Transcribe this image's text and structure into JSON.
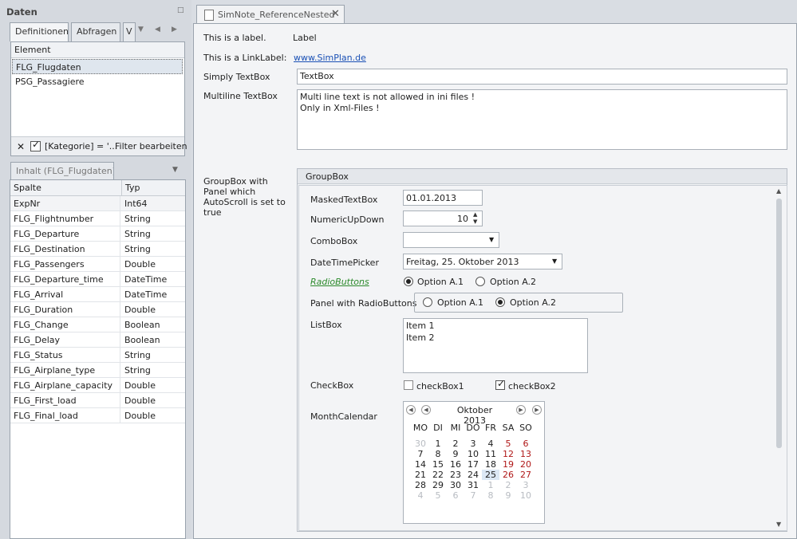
{
  "left": {
    "title": "Daten",
    "tabs": [
      "Definitionen",
      "Abfragen",
      "V"
    ],
    "elements_header": "Element",
    "elements": [
      "FLG_Flugdaten",
      "PSG_Passagiere"
    ],
    "filter_text": "[Kategorie] = '...",
    "filter_edit": "Filter bearbeiten",
    "content_tab": "Inhalt (FLG_Flugdaten)",
    "columns": {
      "col": "Spalte",
      "type": "Typ"
    },
    "rows": [
      {
        "name": "ExpNr",
        "type": "Int64"
      },
      {
        "name": "FLG_Flightnumber",
        "type": "String"
      },
      {
        "name": "FLG_Departure",
        "type": "String"
      },
      {
        "name": "FLG_Destination",
        "type": "String"
      },
      {
        "name": "FLG_Passengers",
        "type": "Double"
      },
      {
        "name": "FLG_Departure_time",
        "type": "DateTime"
      },
      {
        "name": "FLG_Arrival",
        "type": "DateTime"
      },
      {
        "name": "FLG_Duration",
        "type": "Double"
      },
      {
        "name": "FLG_Change",
        "type": "Boolean"
      },
      {
        "name": "FLG_Delay",
        "type": "Boolean"
      },
      {
        "name": "FLG_Status",
        "type": "String"
      },
      {
        "name": "FLG_Airplane_type",
        "type": "String"
      },
      {
        "name": "FLG_Airplane_capacity",
        "type": "Double"
      },
      {
        "name": "FLG_First_load",
        "type": "Double"
      },
      {
        "name": "FLG_Final_load",
        "type": "Double"
      }
    ]
  },
  "doc": {
    "tab_title": "SimNote_ReferenceNested",
    "label_caption": "This is a label.",
    "label_value": "Label",
    "link_caption": "This is a LinkLabel:",
    "link_value": "www.SimPlan.de",
    "textbox_caption": "Simply TextBox",
    "textbox_value": "TextBox",
    "multiline_caption": "Multiline TextBox",
    "multiline_line1": "Multi line text is not allowed in ini files !",
    "multiline_line2": "Only in Xml-Files !",
    "groupbox_caption": "GroupBox with Panel which AutoScroll is set to true",
    "groupbox_title": "GroupBox",
    "masked_label": "MaskedTextBox",
    "masked_value": "01.01.2013",
    "numeric_label": "NumericUpDown",
    "numeric_value": "10",
    "combo_label": "ComboBox",
    "combo_value": "",
    "date_label": "DateTimePicker",
    "date_value": "Freitag, 25. Oktober 2013",
    "radio_label": "RadioButtons",
    "radio_a1": "Option A.1",
    "radio_a2": "Option A.2",
    "panel_radio_label": "Panel with RadioButtons",
    "panel_radio_a1": "Option A.1",
    "panel_radio_a2": "Option A.2",
    "list_label": "ListBox",
    "list_items": [
      "Item 1",
      "Item 2"
    ],
    "checkbox_label": "CheckBox",
    "check1": "checkBox1",
    "check2": "checkBox2",
    "calendar_label": "MonthCalendar",
    "calendar_title": "Oktober 2013",
    "weekdays": [
      "MO",
      "DI",
      "MI",
      "DO",
      "FR",
      "SA",
      "SO"
    ],
    "weeks": [
      [
        "30",
        "1",
        "2",
        "3",
        "4",
        "5",
        "6"
      ],
      [
        "7",
        "8",
        "9",
        "10",
        "11",
        "12",
        "13"
      ],
      [
        "14",
        "15",
        "16",
        "17",
        "18",
        "19",
        "20"
      ],
      [
        "21",
        "22",
        "23",
        "24",
        "25",
        "26",
        "27"
      ],
      [
        "28",
        "29",
        "30",
        "31",
        "1",
        "2",
        "3"
      ],
      [
        "4",
        "5",
        "6",
        "7",
        "8",
        "9",
        "10"
      ]
    ]
  },
  "colors": {
    "link": "#1a50b5",
    "radio_link": "#2c8a2c",
    "weekend": "#b01818",
    "muted": "#b8bcc2",
    "selected_bg": "#dbe7f5"
  }
}
